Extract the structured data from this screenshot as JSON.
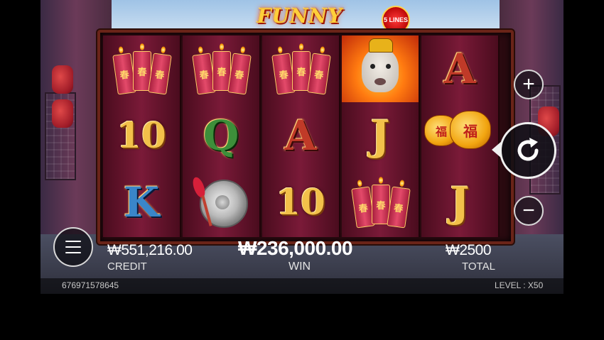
{
  "game": {
    "title": "FUNNY ALPACA",
    "lines_badge": "5 LINES"
  },
  "reels": [
    [
      "firecracker",
      "10",
      "K"
    ],
    [
      "firecracker",
      "Q",
      "gong"
    ],
    [
      "firecracker",
      "A",
      "10"
    ],
    [
      "alpaca",
      "J",
      "firecracker"
    ],
    [
      "A",
      "lanterns",
      "J"
    ]
  ],
  "symbol_text": {
    "firecracker_glyph": "春",
    "lantern_glyph": "福",
    "ten": "10",
    "K": "K",
    "Q": "Q",
    "A": "A",
    "J": "J"
  },
  "stats": {
    "credit_value": "₩551,216.00",
    "credit_label": "CREDIT",
    "win_value": "₩236,000.00",
    "win_label": "WIN",
    "total_value": "₩2500",
    "total_label": "TOTAL"
  },
  "footer": {
    "session_id": "676971578645",
    "level_label": "LEVEL : X50"
  },
  "controls": {
    "plus_glyph": "+",
    "minus_glyph": "−"
  },
  "colors": {
    "gold": "#f2c14a",
    "reel_red": "#7a1a38",
    "frame": "#6a2418"
  }
}
